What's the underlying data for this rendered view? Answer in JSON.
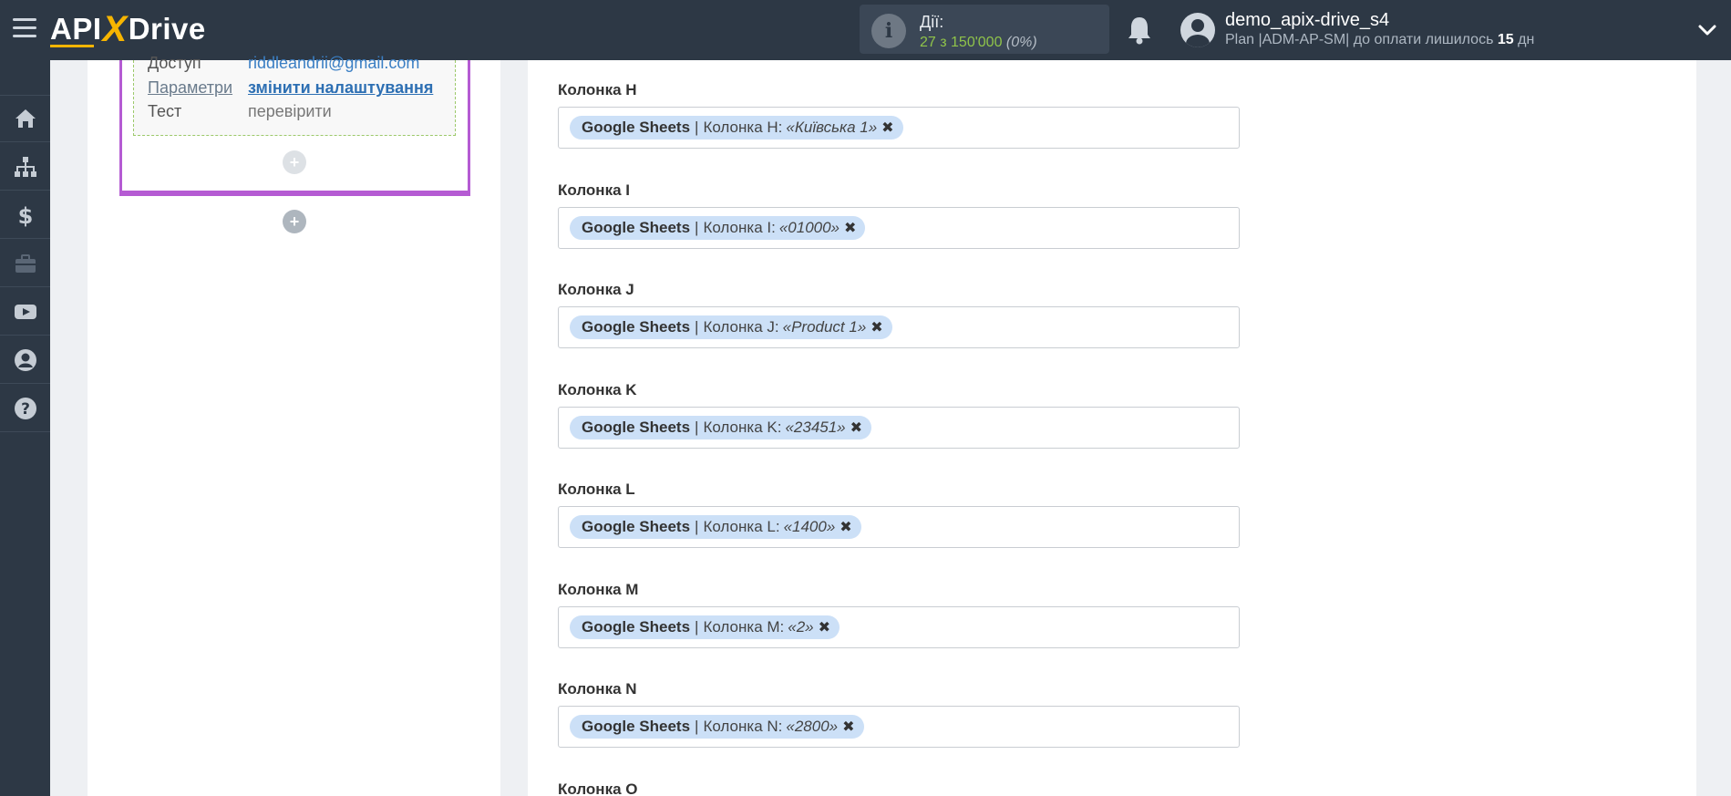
{
  "header": {
    "logo_api": "API",
    "logo_x": "X",
    "logo_drive": "Drive",
    "actions_label": "Дії:",
    "actions_value": "27 з 150'000",
    "actions_percent": "(0%)",
    "user_name": "demo_apix-drive_s4",
    "plan_text": "Plan |ADM-AP-SM| до оплати лишилось",
    "plan_days": "15",
    "plan_days_unit": "дн"
  },
  "sidebar": {
    "items": [
      "home-icon",
      "sitemap-icon",
      "dollar-icon",
      "briefcase-icon",
      "youtube-icon",
      "user-icon",
      "help-icon"
    ]
  },
  "left_panel": {
    "access_label": "Доступ",
    "access_value": "riddleandrii@gmail.com",
    "params_label": "Параметри",
    "params_value": "змінити налаштування",
    "test_label": "Тест",
    "test_value": "перевірити",
    "plus_symbol": "+"
  },
  "fields": [
    {
      "label": "Колонка H",
      "source": "Google Sheets",
      "column": "Колонка H:",
      "value": "«Київська 1»"
    },
    {
      "label": "Колонка I",
      "source": "Google Sheets",
      "column": "Колонка I:",
      "value": "«01000»"
    },
    {
      "label": "Колонка J",
      "source": "Google Sheets",
      "column": "Колонка J:",
      "value": "«Product 1»"
    },
    {
      "label": "Колонка K",
      "source": "Google Sheets",
      "column": "Колонка K:",
      "value": "«23451»"
    },
    {
      "label": "Колонка L",
      "source": "Google Sheets",
      "column": "Колонка L:",
      "value": "«1400»"
    },
    {
      "label": "Колонка M",
      "source": "Google Sheets",
      "column": "Колонка M:",
      "value": "«2»"
    },
    {
      "label": "Колонка N",
      "source": "Google Sheets",
      "column": "Колонка N:",
      "value": "«2800»"
    }
  ],
  "next_field_label": "Колонка O",
  "tag_separator": "|",
  "tag_remove": "✖",
  "colors": {
    "topbar": "#2d3845",
    "accent_yellow": "#f7b500",
    "purple": "#b55bd3",
    "tag_bg": "#cce0f7",
    "green": "#8fc34a"
  }
}
